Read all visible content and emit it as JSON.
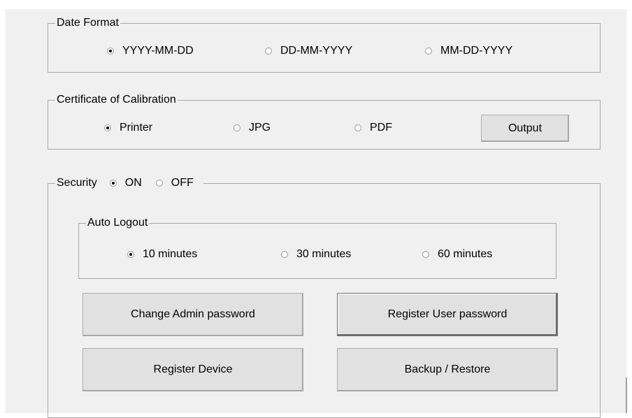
{
  "date_format": {
    "title": "Date Format",
    "options": [
      {
        "label": "YYYY-MM-DD",
        "selected": true
      },
      {
        "label": "DD-MM-YYYY",
        "selected": false
      },
      {
        "label": "MM-DD-YYYY",
        "selected": false
      }
    ]
  },
  "certificate": {
    "title": "Certificate of Calibration",
    "options": [
      {
        "label": "Printer",
        "selected": true
      },
      {
        "label": "JPG",
        "selected": false
      },
      {
        "label": "PDF",
        "selected": false
      }
    ],
    "output_button": "Output"
  },
  "security": {
    "title": "Security",
    "on_label": "ON",
    "off_label": "OFF",
    "on_selected": true,
    "auto_logout": {
      "title": "Auto Logout",
      "options": [
        {
          "label": "10 minutes",
          "selected": true
        },
        {
          "label": "30 minutes",
          "selected": false
        },
        {
          "label": "60 minutes",
          "selected": false
        }
      ]
    },
    "buttons": {
      "change_admin": "Change Admin password",
      "register_user": "Register User password",
      "register_device": "Register Device",
      "backup_restore": "Backup / Restore"
    }
  }
}
